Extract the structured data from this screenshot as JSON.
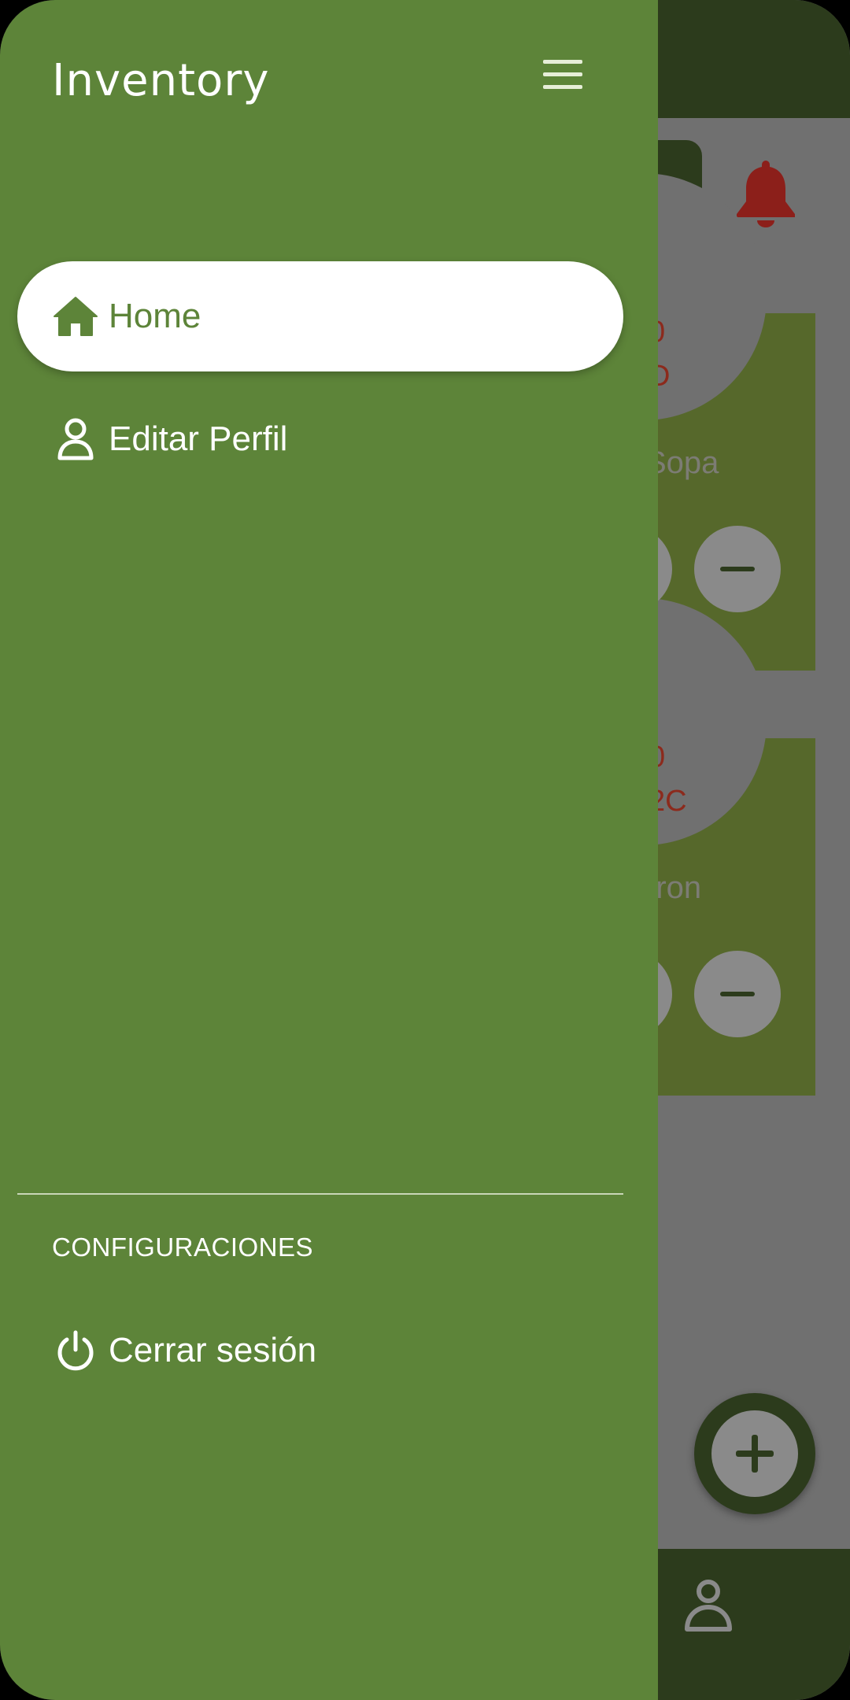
{
  "drawer": {
    "title": "Inventory",
    "items": [
      {
        "label": "Home",
        "icon": "home-icon",
        "active": true
      },
      {
        "label": "Editar Perfil",
        "icon": "user-icon",
        "active": false
      }
    ],
    "section_label": "CONFIGURACIONES",
    "logout_label": "Cerrar sesión"
  },
  "background": {
    "cards": [
      {
        "line1": "0",
        "line2": "D",
        "name": "Sopa"
      },
      {
        "line1": "0",
        "line2": "2C",
        "name": "rron"
      }
    ]
  },
  "colors": {
    "drawer_bg": "#5d8439",
    "active_item_bg": "#ffffff",
    "topbar_bg": "#2c3b1c",
    "alert_red": "#8c1f1a",
    "scrim": "#707070"
  }
}
